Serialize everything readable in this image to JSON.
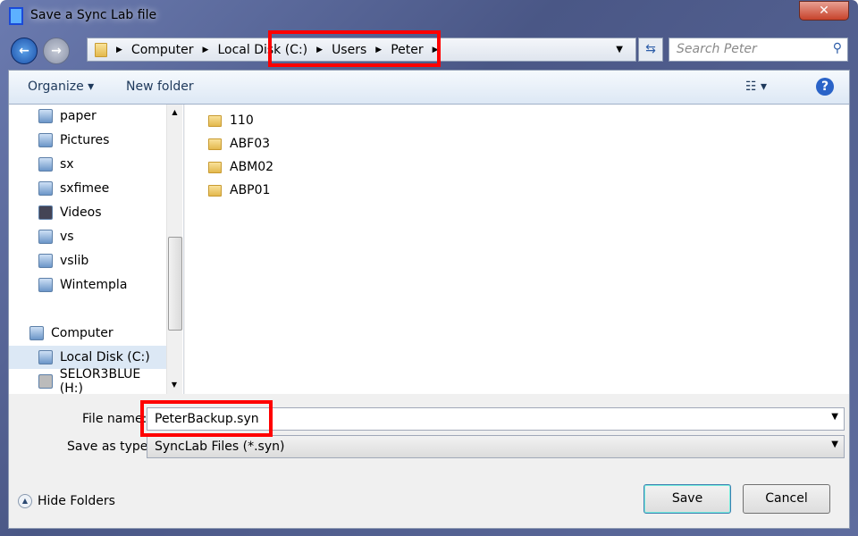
{
  "window": {
    "title": "Save a Sync Lab file",
    "close": "✕"
  },
  "address": {
    "crumbs": [
      "Computer",
      "Local Disk (C:)",
      "Users",
      "Peter"
    ]
  },
  "search": {
    "placeholder": "Search Peter"
  },
  "toolbar": {
    "organize": "Organize ▾",
    "new_folder": "New folder",
    "views": "☷ ▾",
    "help": "?"
  },
  "nav": {
    "items": [
      {
        "label": "paper"
      },
      {
        "label": "Pictures"
      },
      {
        "label": "sx"
      },
      {
        "label": "sxfimee"
      },
      {
        "label": "Videos"
      },
      {
        "label": "vs"
      },
      {
        "label": "vslib"
      },
      {
        "label": "Wintempla"
      },
      {
        "label": "Computer"
      },
      {
        "label": "Local Disk (C:)",
        "selected": true
      },
      {
        "label": "SELOR3BLUE (H:)"
      }
    ]
  },
  "files": [
    {
      "name": "110"
    },
    {
      "name": "ABF03"
    },
    {
      "name": "ABM02"
    },
    {
      "name": "ABP01"
    }
  ],
  "form": {
    "file_name_label": "File name:",
    "file_name_value": "PeterBackup.syn",
    "type_label": "Save as type:",
    "type_value": "SyncLab Files (*.syn)"
  },
  "buttons": {
    "save": "Save",
    "cancel": "Cancel",
    "hide_folders": "Hide Folders"
  },
  "colors": {
    "highlight": "#ff0000"
  }
}
